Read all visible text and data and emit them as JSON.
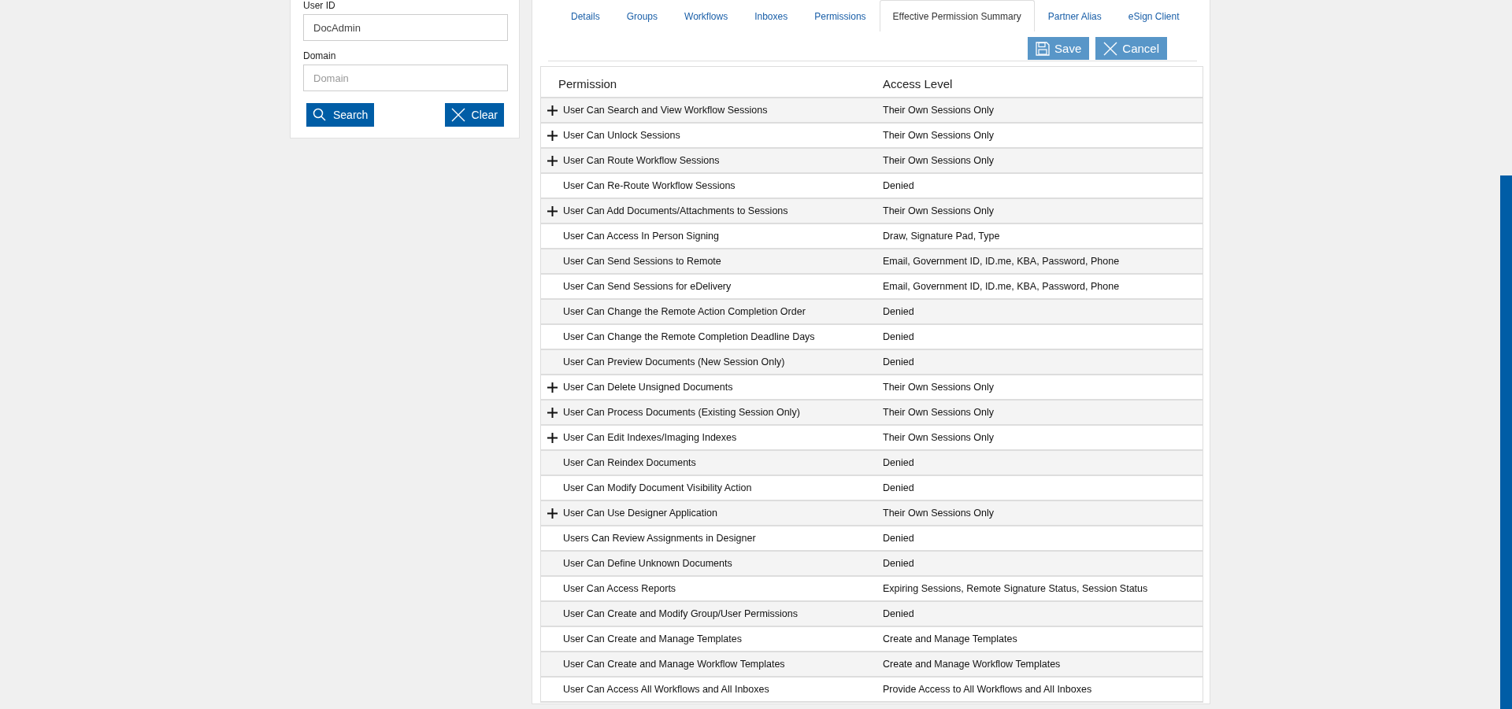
{
  "search_panel": {
    "user_id": {
      "label": "User ID",
      "value": "DocAdmin"
    },
    "domain": {
      "label": "Domain",
      "placeholder": "Domain"
    },
    "buttons": [
      {
        "kind": "search",
        "label": "Search"
      },
      {
        "kind": "clear",
        "label": "Clear"
      }
    ]
  },
  "tabs": [
    {
      "label": "Details",
      "selected": false
    },
    {
      "label": "Groups",
      "selected": false
    },
    {
      "label": "Workflows",
      "selected": false
    },
    {
      "label": "Inboxes",
      "selected": false
    },
    {
      "label": "Permissions",
      "selected": false
    },
    {
      "label": "Effective Permission Summary",
      "selected": true
    },
    {
      "label": "Partner Alias",
      "selected": false
    },
    {
      "label": "eSign Client",
      "selected": false
    }
  ],
  "actions": [
    {
      "kind": "save",
      "label": "Save"
    },
    {
      "kind": "cancel",
      "label": "Cancel"
    }
  ],
  "table": {
    "columns": [
      "Permission",
      "Access Level"
    ],
    "rows": [
      {
        "permission": "User Can Search and View Workflow Sessions",
        "access": "Their Own Sessions Only",
        "expandable": true
      },
      {
        "permission": "User Can Unlock Sessions",
        "access": "Their Own Sessions Only",
        "expandable": true
      },
      {
        "permission": "User Can Route Workflow Sessions",
        "access": "Their Own Sessions Only",
        "expandable": true
      },
      {
        "permission": "User Can Re-Route Workflow Sessions",
        "access": "Denied",
        "expandable": false
      },
      {
        "permission": "User Can Add Documents/Attachments to Sessions",
        "access": "Their Own Sessions Only",
        "expandable": true
      },
      {
        "permission": "User Can Access In Person Signing",
        "access": "Draw, Signature Pad, Type",
        "expandable": false
      },
      {
        "permission": "User Can Send Sessions to Remote",
        "access": "Email, Government ID, ID.me, KBA, Password, Phone",
        "expandable": false
      },
      {
        "permission": "User Can Send Sessions for eDelivery",
        "access": "Email, Government ID, ID.me, KBA, Password, Phone",
        "expandable": false
      },
      {
        "permission": "User Can Change the Remote Action Completion Order",
        "access": "Denied",
        "expandable": false
      },
      {
        "permission": "User Can Change the Remote Completion Deadline Days",
        "access": "Denied",
        "expandable": false
      },
      {
        "permission": "User Can Preview Documents (New Session Only)",
        "access": "Denied",
        "expandable": false
      },
      {
        "permission": "User Can Delete Unsigned Documents",
        "access": "Their Own Sessions Only",
        "expandable": true
      },
      {
        "permission": "User Can Process Documents (Existing Session Only)",
        "access": "Their Own Sessions Only",
        "expandable": true
      },
      {
        "permission": "User Can Edit Indexes/Imaging Indexes",
        "access": "Their Own Sessions Only",
        "expandable": true
      },
      {
        "permission": "User Can Reindex Documents",
        "access": "Denied",
        "expandable": false
      },
      {
        "permission": "User Can Modify Document Visibility Action",
        "access": "Denied",
        "expandable": false
      },
      {
        "permission": "User Can Use Designer Application",
        "access": "Their Own Sessions Only",
        "expandable": true
      },
      {
        "permission": "Users Can Review Assignments in Designer",
        "access": "Denied",
        "expandable": false
      },
      {
        "permission": "User Can Define Unknown Documents",
        "access": "Denied",
        "expandable": false
      },
      {
        "permission": "User Can Access Reports",
        "access": "Expiring Sessions, Remote Signature Status, Session Status",
        "expandable": false
      },
      {
        "permission": "User Can Create and Modify Group/User Permissions",
        "access": "Denied",
        "expandable": false
      },
      {
        "permission": "User Can Create and Manage Templates",
        "access": "Create and Manage Templates",
        "expandable": false
      },
      {
        "permission": "User Can Create and Manage Workflow Templates",
        "access": "Create and Manage Workflow Templates",
        "expandable": false
      },
      {
        "permission": "User Can Access All Workflows and All Inboxes",
        "access": "Provide Access to All Workflows and All Inboxes",
        "expandable": false
      }
    ]
  }
}
